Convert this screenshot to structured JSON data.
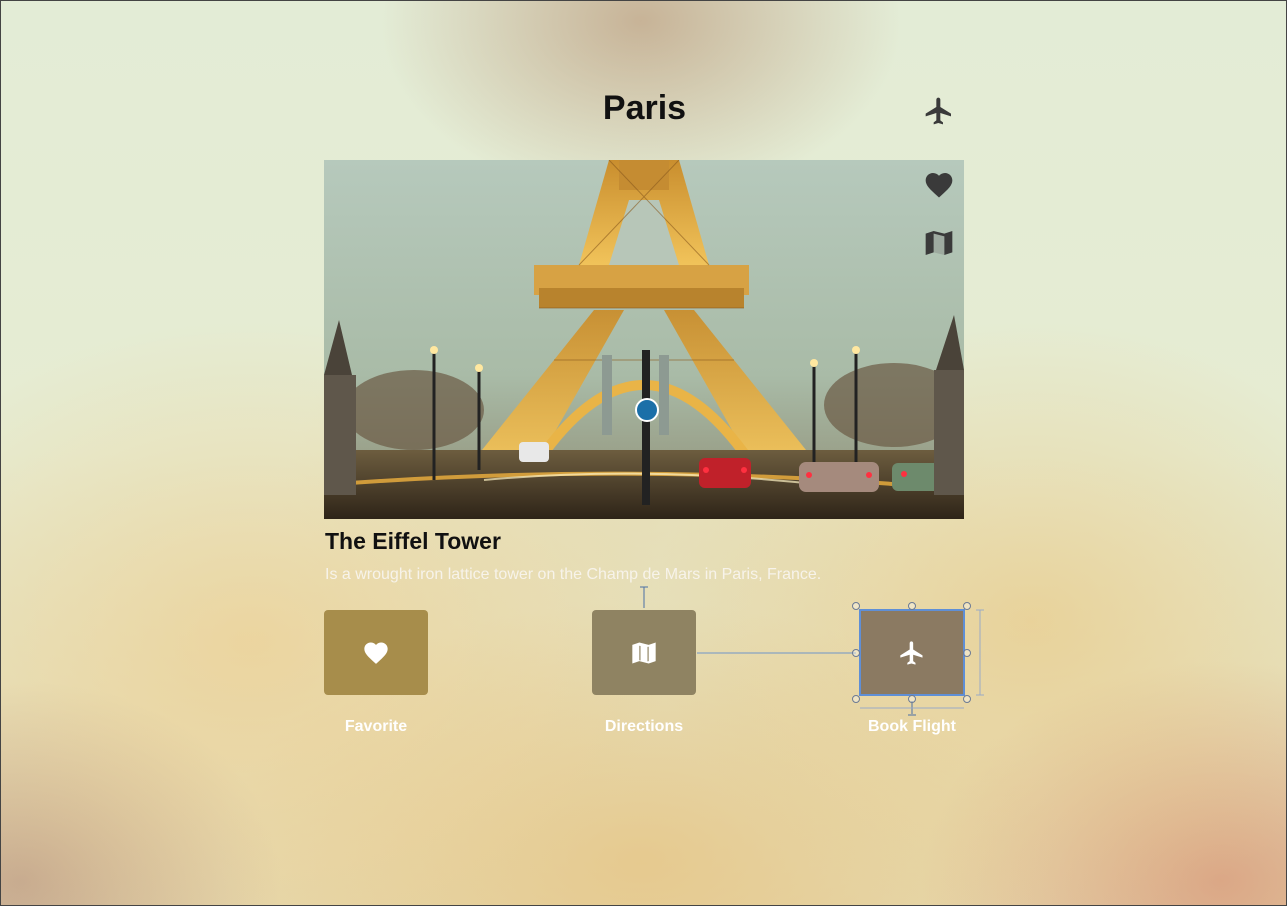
{
  "header": {
    "title": "Paris",
    "flight_icon": "airplane-icon"
  },
  "hero": {
    "image_subject": "Eiffel Tower at dusk with street traffic",
    "favorite_icon": "heart-icon",
    "directions_icon": "map-icon"
  },
  "landmark": {
    "name": "The Eiffel Tower",
    "description": "Is a wrought iron lattice tower on the Champ de Mars in Paris, France."
  },
  "actions": [
    {
      "label": "Favorite",
      "icon": "heart-icon",
      "color": "#a78d4b"
    },
    {
      "label": "Directions",
      "icon": "map-icon",
      "color": "#8f8362"
    },
    {
      "label": "Book Flight",
      "icon": "airplane-icon",
      "color": "#8b7a62",
      "selected": true
    }
  ],
  "colors": {
    "title_text": "#111111",
    "icon_dark": "#3a3a3a",
    "icon_light": "#ffffff",
    "selection": "#5f8fd6"
  }
}
